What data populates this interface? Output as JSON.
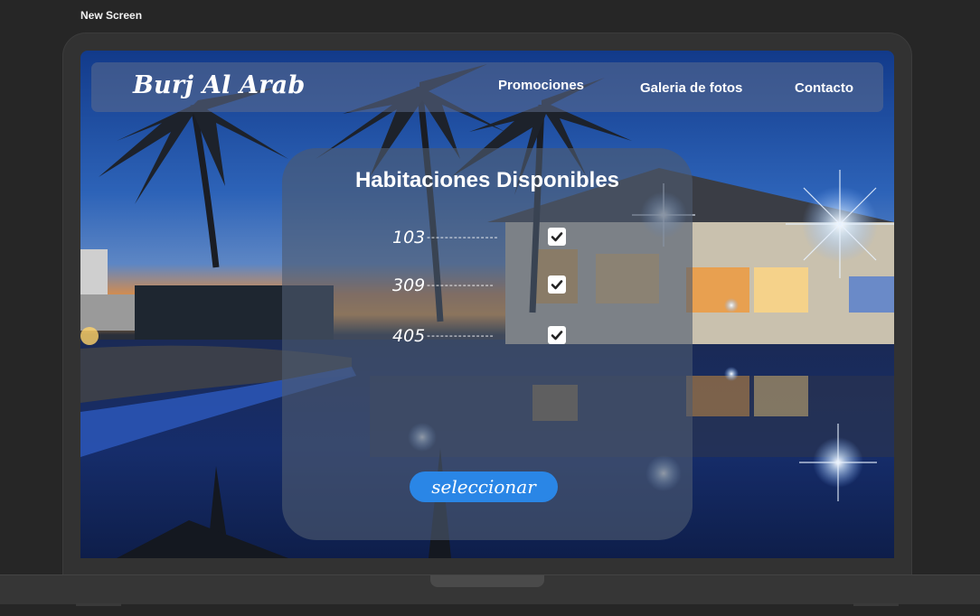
{
  "frame": {
    "label": "New Screen"
  },
  "navbar": {
    "brand": "Burj Al Arab",
    "links": [
      "Promociones",
      "Galeria de fotos",
      "Contacto"
    ]
  },
  "card": {
    "title": "Habitaciones Disponibles",
    "rooms": [
      {
        "number": "103",
        "dashes": "----------------",
        "checked": true
      },
      {
        "number": "309",
        "dashes": "---------------",
        "checked": true
      },
      {
        "number": "405",
        "dashes": "---------------",
        "checked": true
      }
    ],
    "button": "seleccionar"
  },
  "icons": {
    "check": "checkmark-icon",
    "background": "pool-at-night-photo"
  },
  "colors": {
    "page_bg": "#262626",
    "laptop": "#323232",
    "accent": "#2a86e6",
    "card_bg": "rgba(78,90,112,0.62)",
    "navbar_bg": "rgba(92,108,140,0.55)"
  }
}
